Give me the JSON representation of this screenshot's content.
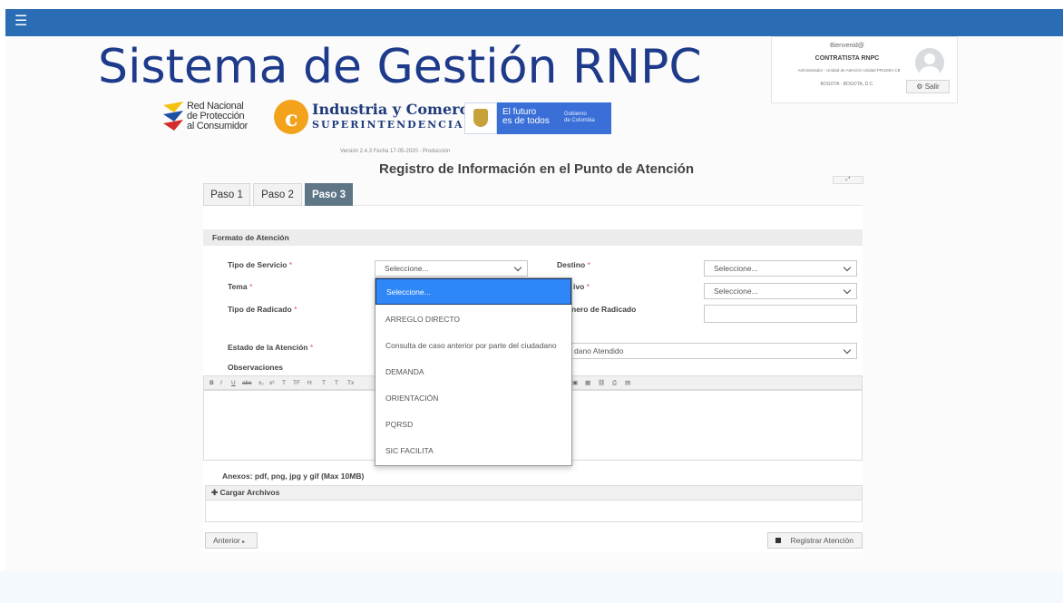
{
  "header": {
    "menu_icon": "hamburger-icon",
    "system_title": "Sistema de Gestión RNPC",
    "logos": {
      "rnpc_text": "Red Nacional\nde Protección\nal Consumidor",
      "sic_title": "Industria y Comercio",
      "sic_subtitle": "SUPERINTENDENCIA",
      "gob_text": "El futuro\nes de todos",
      "gob_small": "Gobierno\nde Colombia"
    },
    "version": "Versión 2.4.3 Fecha 17-05-2020 - Producción"
  },
  "user_box": {
    "greeting": "Bienvenid@",
    "name": "CONTRATISTA RNPC",
    "role": "Administrador - Unidad de Atención Unidad PRUEBA CB",
    "location": "BOGOTA - BOGOTA, D.C.",
    "logout_label": "Salir"
  },
  "form": {
    "title": "Registro de Información en el Punto de Atención",
    "tabs": [
      "Paso 1",
      "Paso 2",
      "Paso 3"
    ],
    "active_tab": "Paso 3",
    "section_title": "Formato de Atención",
    "required_mark": "*",
    "fields": {
      "tipo_servicio_label": "Tipo de Servicio",
      "tipo_servicio_value": "Seleccione...",
      "destino_label": "Destino",
      "destino_value": "Seleccione...",
      "tema_label": "Tema",
      "motivo_label_visible": "ivo",
      "motivo_value": "Seleccione...",
      "tipo_radicado_label": "Tipo de Radicado",
      "numero_radicado_label_visible": "nero de Radicado",
      "numero_radicado_value": "",
      "estado_label": "Estado de la Atención",
      "estado_value_visible": "dano Atendido",
      "observaciones_label": "Observaciones"
    },
    "dropdown_options": [
      "Seleccione...",
      "ARREGLO DIRECTO",
      "Consulta de caso anterior por parte del ciudadano",
      "DEMANDA",
      "ORIENTACIÓN",
      "PQRSD",
      "SIC FACILITA"
    ],
    "anexos_label": "Anexos: pdf, png, jpg y gif (Max 10MB)",
    "upload_label": "Cargar Archivos",
    "prev_button": "Anterior",
    "submit_button": "Registrar Atención"
  },
  "colors": {
    "topbar": "#2a6db4",
    "title": "#1e3a8a",
    "active_tab": "#5f7687",
    "dropdown_selected": "#2f86f6"
  }
}
